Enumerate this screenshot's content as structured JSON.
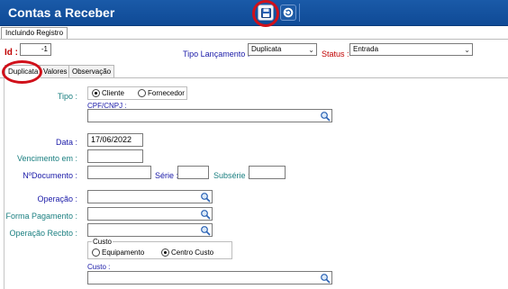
{
  "window": {
    "title": "Contas a Receber"
  },
  "toolbar": {
    "save_icon": "save-icon",
    "undo_icon": "undo-icon"
  },
  "status_tab": {
    "label": "Incluindo Registro"
  },
  "header": {
    "id_label": "Id :",
    "id_value": "-1",
    "tipo_lancamento_label": "Tipo Lançamento :",
    "tipo_lancamento_value": "Duplicata",
    "status_label": "Status :",
    "status_value": "Entrada"
  },
  "tabs": [
    {
      "label": "Duplicata",
      "active": true
    },
    {
      "label": "Valores",
      "active": false
    },
    {
      "label": "Observação",
      "active": false
    }
  ],
  "form": {
    "tipo_label": "Tipo :",
    "tipo_options": [
      {
        "label": "Cliente",
        "selected": true
      },
      {
        "label": "Fornecedor",
        "selected": false
      }
    ],
    "cpf_cnpj_label": "CPF/CNPJ :",
    "cpf_cnpj_value": "",
    "data_label": "Data :",
    "data_value": "17/06/2022",
    "vencimento_label": "Vencimento em :",
    "vencimento_value": "",
    "numero_documento_label": "NºDocumento :",
    "numero_documento_value": "",
    "serie_label": "Série :",
    "serie_value": "",
    "subserie_label": "Subsérie :",
    "subserie_value": "",
    "operacao_label": "Operação :",
    "operacao_value": "",
    "forma_pagamento_label": "Forma Pagamento :",
    "forma_pagamento_value": "",
    "operacao_recbto_label": "Operação Recbto :",
    "operacao_recbto_value": "",
    "custo_group_label": "Custo",
    "custo_options": [
      {
        "label": "Equipamento",
        "selected": false
      },
      {
        "label": "Centro Custo",
        "selected": true
      }
    ],
    "custo_label": "Custo :",
    "custo_value": ""
  },
  "colors": {
    "titlebar": "#1a5aa8",
    "highlight_ring": "#d0101a",
    "label_teal": "#1a7f80",
    "label_navy": "#1a1aa8",
    "label_red": "#c00000"
  }
}
